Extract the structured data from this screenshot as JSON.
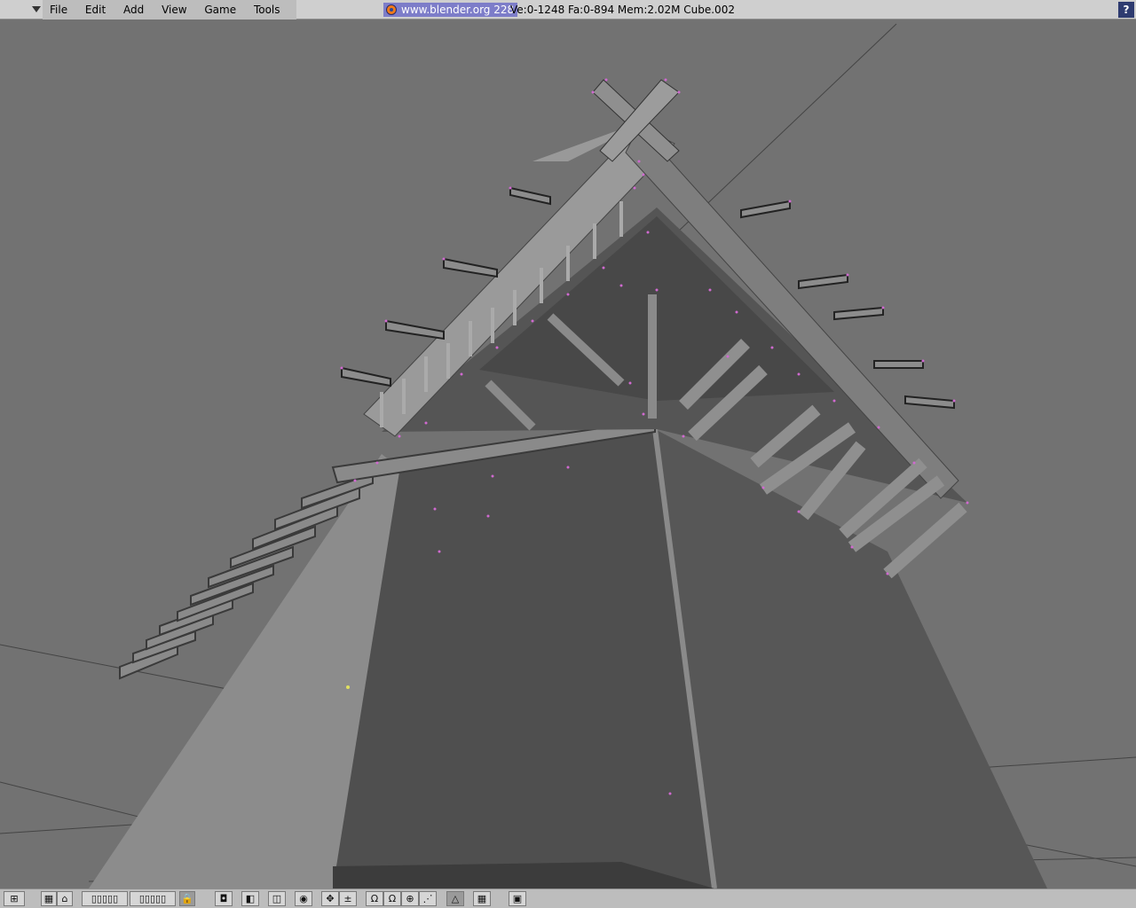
{
  "menu": [
    "File",
    "Edit",
    "Add",
    "View",
    "Game",
    "Tools"
  ],
  "brand": "www.blender.org 228",
  "stats": "Ve:0-1248 Fa:0-894  Mem:2.02M  Cube.002",
  "help_label": "?",
  "toolbar": [
    {
      "name": "view-type-icon",
      "glyph": "⊞"
    },
    {
      "name": "grid-layers-icon",
      "glyph": "▦"
    },
    {
      "name": "home-icon",
      "glyph": "⌂"
    },
    {
      "name": "layer-buttons",
      "glyph": "▯▯▯▯▯"
    },
    {
      "name": "layer-buttons-2",
      "glyph": "▯▯▯▯▯"
    },
    {
      "name": "lock-icon",
      "glyph": "🔒"
    },
    {
      "name": "pivot-icon",
      "glyph": "◘"
    },
    {
      "name": "draw-type-icon",
      "glyph": "◧"
    },
    {
      "name": "mode-icon",
      "glyph": "◫"
    },
    {
      "name": "shading-icon",
      "glyph": "◉"
    },
    {
      "name": "manipulator-translate-icon",
      "glyph": "✥"
    },
    {
      "name": "manipulator-scale-icon",
      "glyph": "±"
    },
    {
      "name": "rotate-icon",
      "glyph": "Ω"
    },
    {
      "name": "rotate-2-icon",
      "glyph": "Ω"
    },
    {
      "name": "snap-icon",
      "glyph": "⊕"
    },
    {
      "name": "proportional-icon",
      "glyph": "⋰"
    },
    {
      "name": "triangle-icon",
      "glyph": "△"
    },
    {
      "name": "grid-icon",
      "glyph": "▦"
    },
    {
      "name": "render-icon",
      "glyph": "▣"
    }
  ]
}
